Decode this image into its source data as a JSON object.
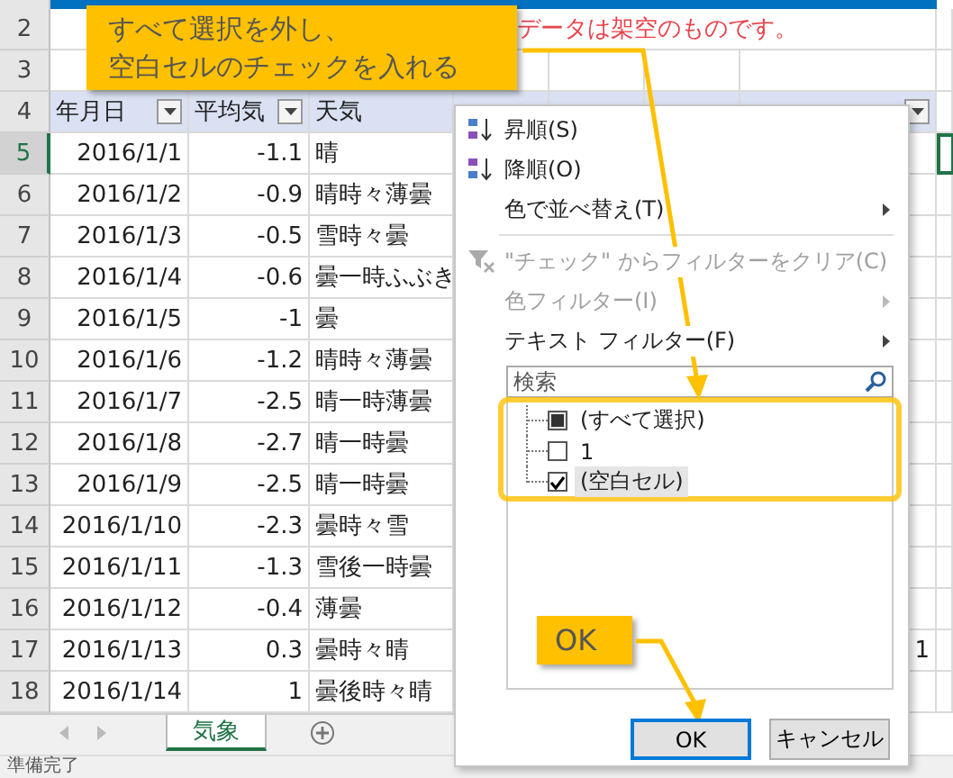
{
  "note_row": {
    "number": "2",
    "note": "データは架空のものです。"
  },
  "blank_row": {
    "number": "3"
  },
  "header_row": {
    "number": "4",
    "columns": [
      {
        "label": "年月日",
        "filter": true
      },
      {
        "label": "平均気",
        "filter": true
      },
      {
        "label": "天気",
        "filter": false
      },
      {
        "filter": true
      }
    ]
  },
  "rows": [
    {
      "number": "5",
      "active": true,
      "date": "2016/1/1",
      "temp": "-1.1",
      "weather": "晴"
    },
    {
      "number": "6",
      "active": false,
      "date": "2016/1/2",
      "temp": "-0.9",
      "weather": "晴時々薄曇"
    },
    {
      "number": "7",
      "active": false,
      "date": "2016/1/3",
      "temp": "-0.5",
      "weather": "雪時々曇"
    },
    {
      "number": "8",
      "active": false,
      "date": "2016/1/4",
      "temp": "-0.6",
      "weather": "曇一時ふぶき"
    },
    {
      "number": "9",
      "active": false,
      "date": "2016/1/5",
      "temp": "-1",
      "weather": "曇"
    },
    {
      "number": "10",
      "active": false,
      "date": "2016/1/6",
      "temp": "-1.2",
      "weather": "晴時々薄曇"
    },
    {
      "number": "11",
      "active": false,
      "date": "2016/1/7",
      "temp": "-2.5",
      "weather": "晴一時薄曇"
    },
    {
      "number": "12",
      "active": false,
      "date": "2016/1/8",
      "temp": "-2.7",
      "weather": "晴一時曇"
    },
    {
      "number": "13",
      "active": false,
      "date": "2016/1/9",
      "temp": "-2.5",
      "weather": "晴一時曇"
    },
    {
      "number": "14",
      "active": false,
      "date": "2016/1/10",
      "temp": "-2.3",
      "weather": "曇時々雪"
    },
    {
      "number": "15",
      "active": false,
      "date": "2016/1/11",
      "temp": "-1.3",
      "weather": "雪後一時曇"
    },
    {
      "number": "16",
      "active": false,
      "date": "2016/1/12",
      "temp": "-0.4",
      "weather": "薄曇"
    },
    {
      "number": "17",
      "active": false,
      "date": "2016/1/13",
      "temp": "0.3",
      "weather": "曇時々晴",
      "extra": "1"
    },
    {
      "number": "18",
      "active": false,
      "date": "2016/1/14",
      "temp": "1",
      "weather": "曇後時々晴"
    }
  ],
  "sheet_tabs": [
    {
      "label": "気象",
      "selected": true
    }
  ],
  "status_bar": {
    "text": "準備完了"
  },
  "filter_menu": {
    "items": [
      {
        "kind": "sort-asc",
        "label": "昇順(S)",
        "disabled": false,
        "submenu": false
      },
      {
        "kind": "sort-desc",
        "label": "降順(O)",
        "disabled": false,
        "submenu": false
      },
      {
        "kind": "plain",
        "label": "色で並べ替え(T)",
        "disabled": false,
        "submenu": true
      },
      {
        "kind": "separator"
      },
      {
        "kind": "clear-filter",
        "label": "\"チェック\" からフィルターをクリア(C)",
        "disabled": true,
        "submenu": false
      },
      {
        "kind": "plain",
        "label": "色フィルター(I)",
        "disabled": true,
        "submenu": true
      },
      {
        "kind": "plain",
        "label": "テキスト フィルター(F)",
        "disabled": false,
        "submenu": true
      }
    ],
    "search": {
      "placeholder": "検索"
    },
    "values": [
      {
        "label": "(すべて選択)",
        "checked": false,
        "partial": true,
        "selected": false
      },
      {
        "label": "1",
        "checked": false,
        "partial": false,
        "selected": false
      },
      {
        "label": "(空白セル)",
        "checked": true,
        "partial": false,
        "selected": true
      }
    ],
    "buttons": [
      {
        "label": "OK",
        "default": true
      },
      {
        "label": "キャンセル",
        "default": false
      }
    ]
  },
  "callouts": [
    {
      "lines": [
        "すべて選択を外し、",
        "空白セルのチェックを入れる"
      ]
    },
    {
      "lines": [
        "OK"
      ]
    }
  ]
}
